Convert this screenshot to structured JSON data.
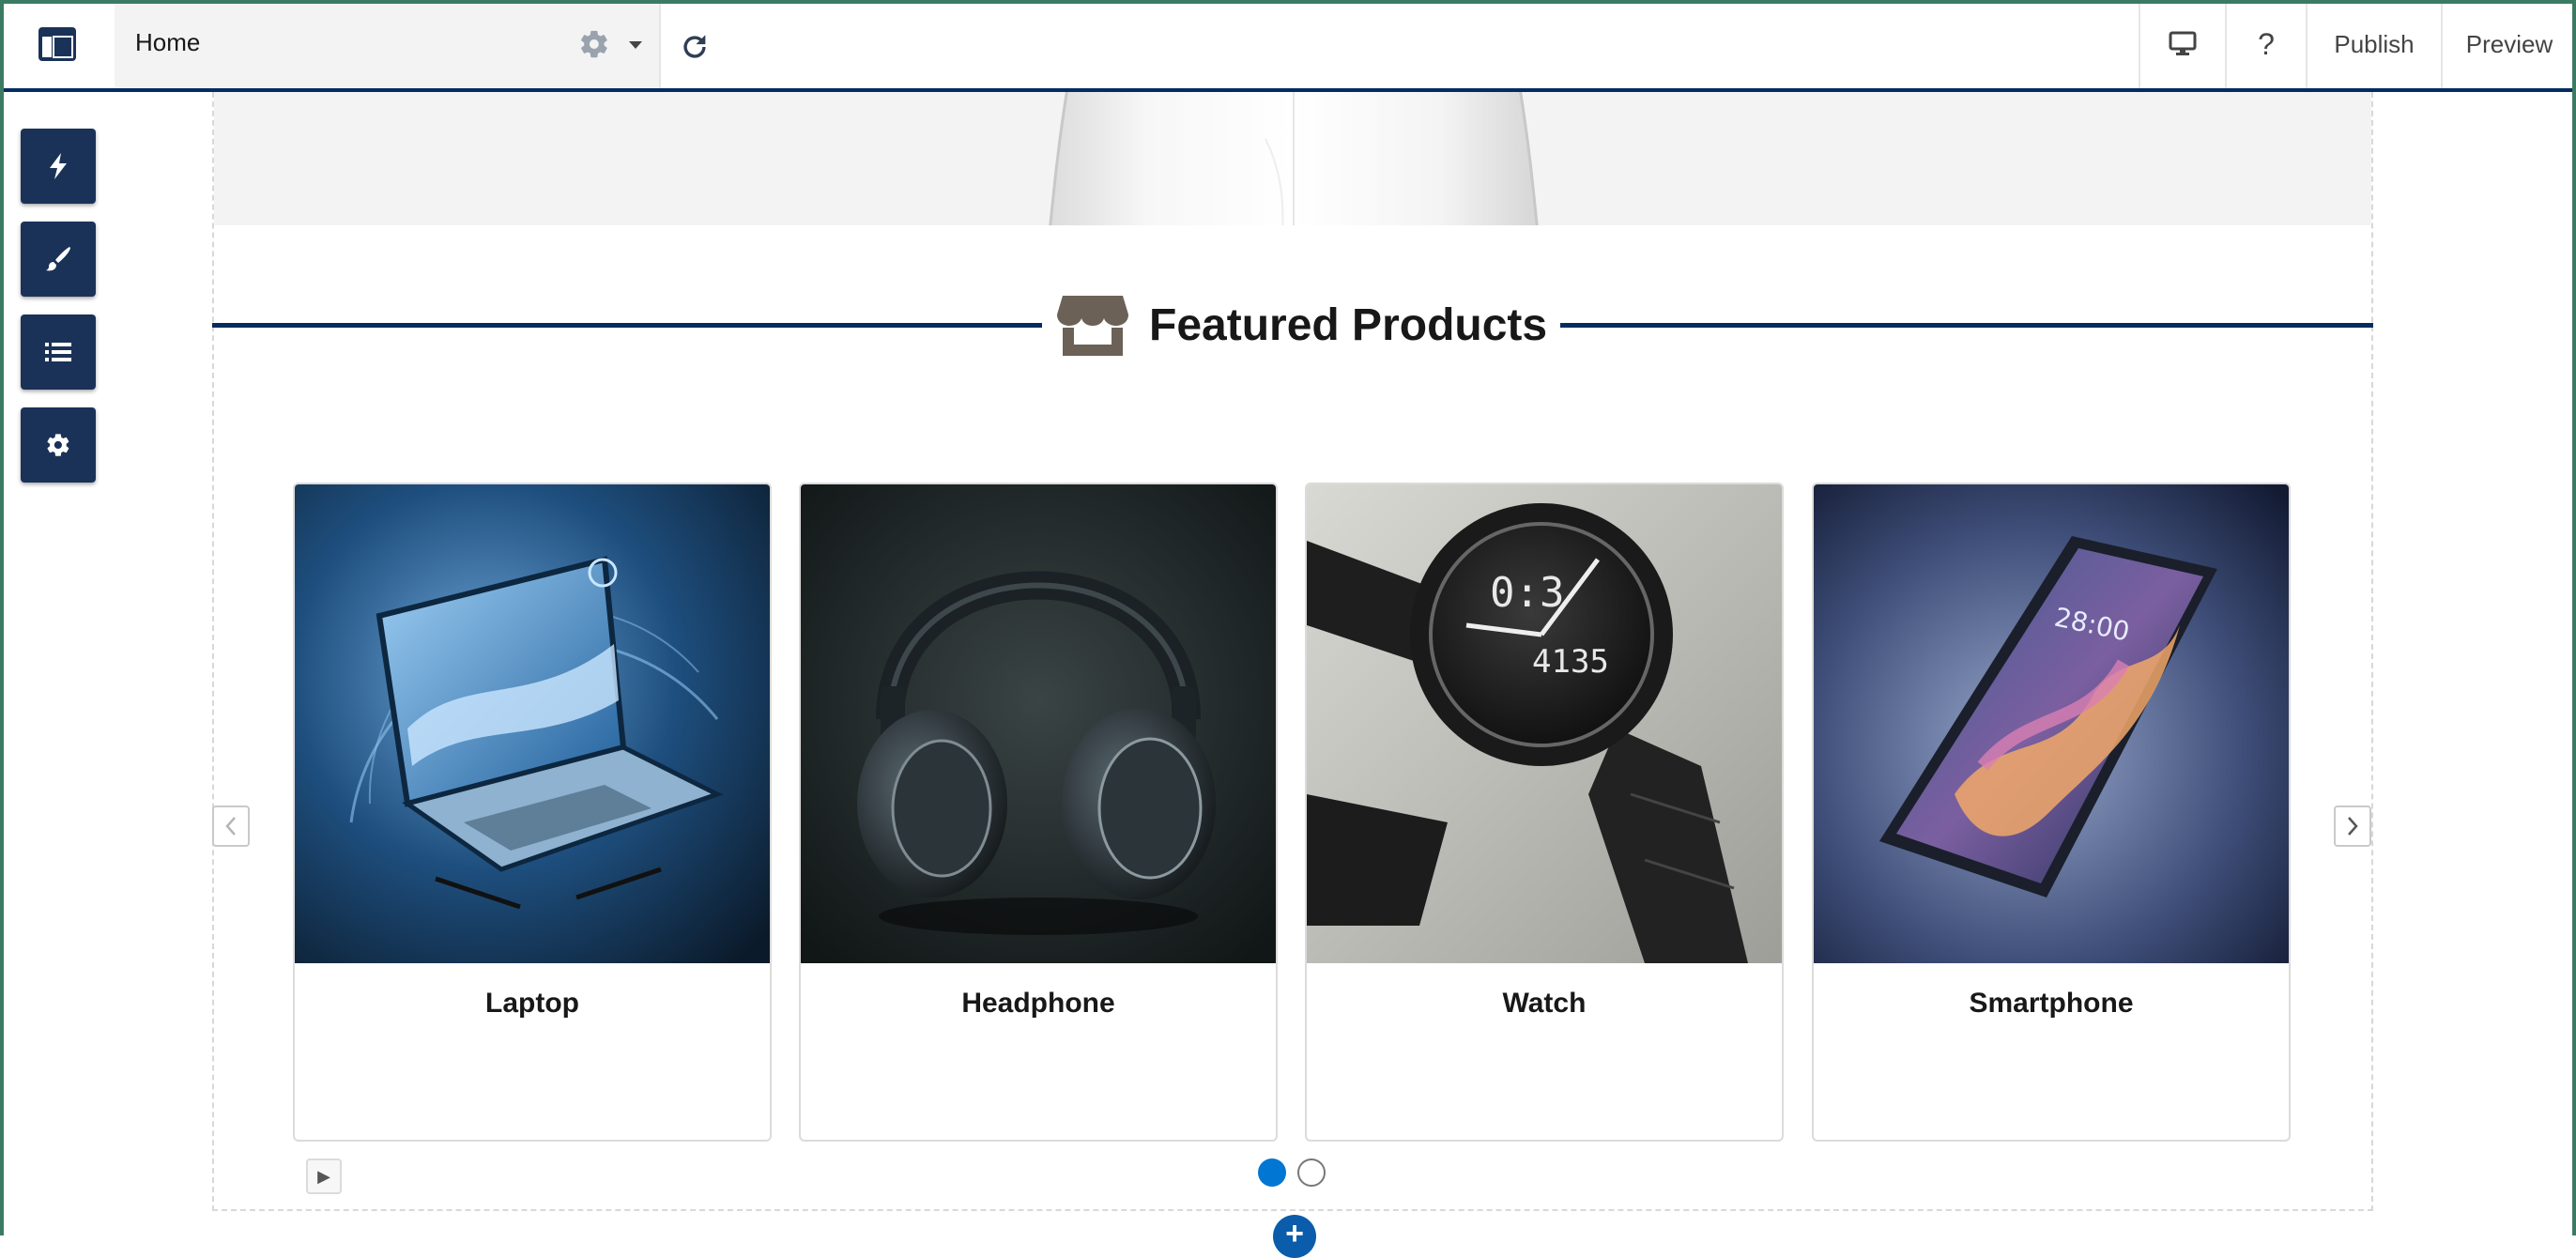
{
  "header": {
    "page_name": "Home",
    "publish_label": "Publish",
    "preview_label": "Preview",
    "help_label": "?"
  },
  "left_tools": [
    {
      "icon": "lightning-icon"
    },
    {
      "icon": "brush-icon"
    },
    {
      "icon": "list-icon"
    },
    {
      "icon": "gear-icon"
    }
  ],
  "section": {
    "title": "Featured Products",
    "icon": "store-icon"
  },
  "products": [
    {
      "name": "Laptop"
    },
    {
      "name": "Headphone"
    },
    {
      "name": "Watch"
    },
    {
      "name": "Smartphone"
    }
  ],
  "carousel": {
    "pages": 2,
    "active_page": 1,
    "autoplay_label": "▶"
  },
  "add_label": "+",
  "colors": {
    "brand_navy": "#032d60",
    "tool_bg": "#1b3258",
    "accent_blue": "#0176d3"
  }
}
